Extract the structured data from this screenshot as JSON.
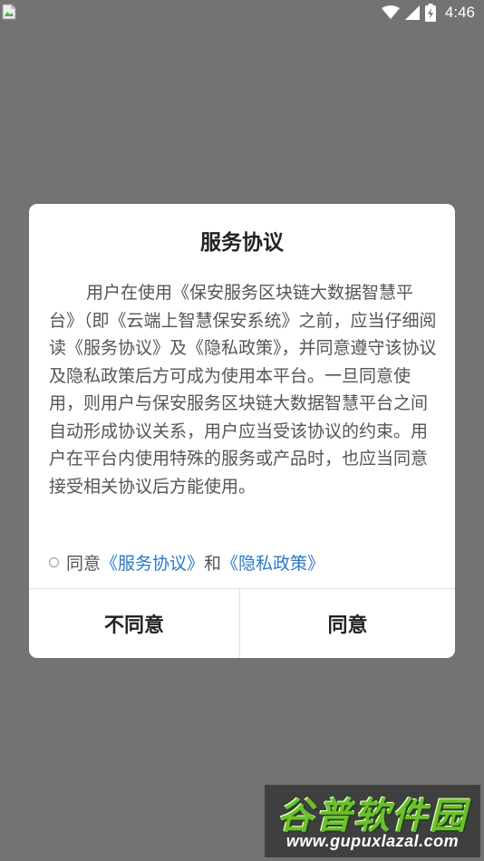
{
  "status_bar": {
    "time": "4:46",
    "icons": [
      "broken-image-icon",
      "wifi-icon",
      "signal-icon",
      "battery-charging-icon"
    ]
  },
  "dialog": {
    "title": "服务协议",
    "body": "用户在使用《保安服务区块链大数据智慧平台》（即《云端上智慧保安系统》之前，应当仔细阅读《服务协议》及《隐私政策》，并同意遵守该协议及隐私政策后方可成为使用本平台。一旦同意使用，则用户与保安服务区块链大数据智慧平台之间自动形成协议关系，用户应当受该协议的约束。用户在平台内使用特殊的服务或产品时，也应当同意接受相关协议后方能使用。",
    "agree_prefix": "同意",
    "link_service": "《服务协议》",
    "agree_conjunction": "和",
    "link_privacy": "《隐私政策》",
    "disagree_label": "不同意",
    "agree_label": "同意"
  },
  "watermark": {
    "title": "谷普软件园",
    "url": "www.gupuxlazal.com"
  },
  "colors": {
    "overlay": "#737373",
    "dialog_bg": "#ffffff",
    "link": "#2a79c8",
    "text": "#555555",
    "title": "#222222",
    "watermark_green": "#6bc12a"
  }
}
